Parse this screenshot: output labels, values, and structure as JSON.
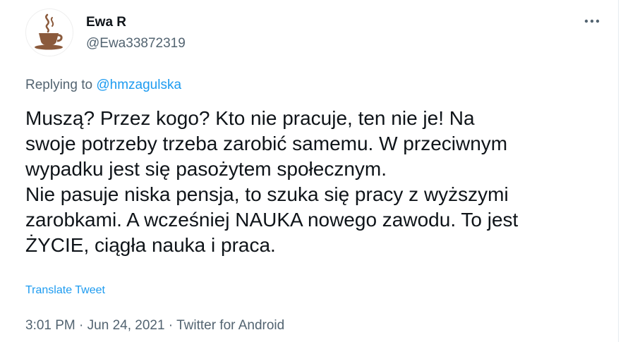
{
  "author": {
    "name": "Ewa R",
    "handle": "@Ewa33872319",
    "avatar_icon": "coffee-cup-icon"
  },
  "menu": {
    "icon": "more-horizontal-icon"
  },
  "reply": {
    "prefix": "Replying to ",
    "mention": "@hmzagulska"
  },
  "tweet": {
    "lines": [
      "Muszą? Przez kogo? Kto nie pracuje, ten nie je! Na",
      "swoje potrzeby trzeba zarobić samemu. W przeciwnym",
      "wypadku jest się pasożytem społecznym.",
      "Nie pasuje niska pensja, to szuka się pracy z wyższymi",
      "zarobkami. A wcześniej NAUKA nowego zawodu. To jest",
      "ŻYCIE, ciągła nauka i praca."
    ]
  },
  "translate_label": "Translate Tweet",
  "meta": {
    "time": "3:01 PM",
    "sep1": " · ",
    "date": "Jun 24, 2021",
    "sep2": " · ",
    "app": "Twitter for Android"
  },
  "colors": {
    "link": "#1d9bf0",
    "muted": "#536471",
    "text": "#0f1419",
    "avatar_brown": "#8b5a3c"
  }
}
